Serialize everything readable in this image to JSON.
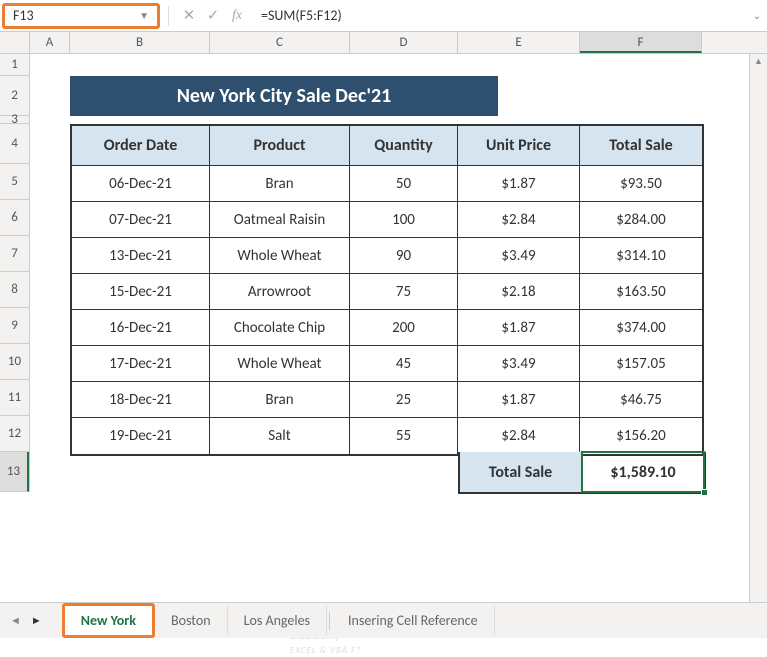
{
  "name_box": "F13",
  "formula": "=SUM(F5:F12)",
  "columns": [
    "A",
    "B",
    "C",
    "D",
    "E",
    "F"
  ],
  "row_numbers": [
    1,
    2,
    3,
    4,
    5,
    6,
    7,
    8,
    9,
    10,
    11,
    12,
    13
  ],
  "title": "New York City Sale Dec'21",
  "headers": {
    "order_date": "Order Date",
    "product": "Product",
    "quantity": "Quantity",
    "unit_price": "Unit Price",
    "total_sale": "Total Sale"
  },
  "rows": [
    {
      "date": "06-Dec-21",
      "product": "Bran",
      "qty": "50",
      "price": "$1.87",
      "total": "$93.50"
    },
    {
      "date": "07-Dec-21",
      "product": "Oatmeal Raisin",
      "qty": "100",
      "price": "$2.84",
      "total": "$284.00"
    },
    {
      "date": "13-Dec-21",
      "product": "Whole Wheat",
      "qty": "90",
      "price": "$3.49",
      "total": "$314.10"
    },
    {
      "date": "15-Dec-21",
      "product": "Arrowroot",
      "qty": "75",
      "price": "$2.18",
      "total": "$163.50"
    },
    {
      "date": "16-Dec-21",
      "product": "Chocolate Chip",
      "qty": "200",
      "price": "$1.87",
      "total": "$374.00"
    },
    {
      "date": "17-Dec-21",
      "product": "Whole Wheat",
      "qty": "45",
      "price": "$3.49",
      "total": "$157.05"
    },
    {
      "date": "18-Dec-21",
      "product": "Bran",
      "qty": "25",
      "price": "$1.87",
      "total": "$46.75"
    },
    {
      "date": "19-Dec-21",
      "product": "Salt",
      "qty": "55",
      "price": "$2.84",
      "total": "$156.20"
    }
  ],
  "total_label": "Total Sale",
  "total_value": "$1,589.10",
  "tabs": {
    "active": "New York",
    "t2": "Boston",
    "t3": "Los Angeles",
    "t4": "Insering Cell Reference"
  },
  "watermark": {
    "main": "exceldemy",
    "sub": "EXCEL & VBA F?"
  }
}
